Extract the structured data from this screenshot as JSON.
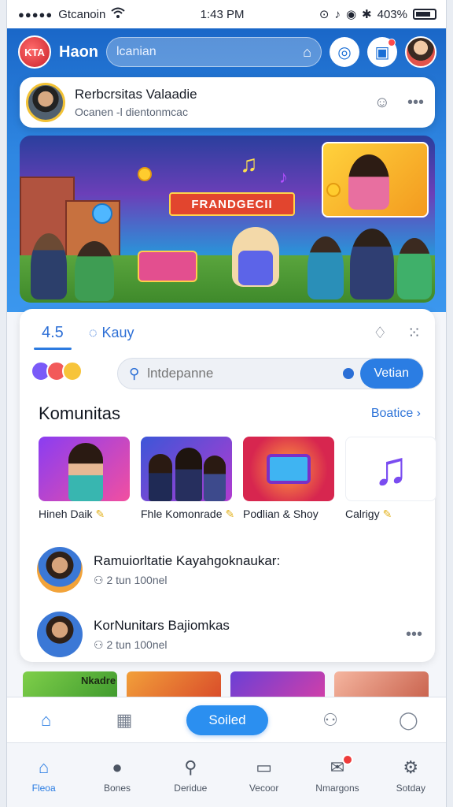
{
  "status_bar": {
    "carrier": "Gtcanoin",
    "time": "1:43 PM",
    "battery": "403%"
  },
  "header": {
    "logo_text": "KTA",
    "brand": "Haon",
    "search_placeholder": "lcanian"
  },
  "profile": {
    "name": "Rerbcrsitas Valaadie",
    "subtitle": "Ocanen -l dientonmcac"
  },
  "hero": {
    "ribbon": "FRANDGECII"
  },
  "tabs": {
    "count": "4.5",
    "second_label": "Kauy"
  },
  "search": {
    "placeholder": "lntdepanne",
    "button": "Vetian"
  },
  "community": {
    "title": "Komunitas",
    "link": "Boatice",
    "tiles": [
      {
        "label": "Hineh Daik"
      },
      {
        "label": "Fhle Komonrade"
      },
      {
        "label": "Podlian & Shoy"
      },
      {
        "label": "Calrigy"
      }
    ]
  },
  "list": [
    {
      "title": "Ramuiorltatie Kayahgoknaukar:",
      "meta": "2 tun 100nel"
    },
    {
      "title": "KorNunitars Bajiomkas",
      "meta": "2 tun 100nel"
    }
  ],
  "strip": {
    "first_label": "Nkadre"
  },
  "actionbar": {
    "primary": "Soiled"
  },
  "nav": [
    {
      "label": "Fleoa"
    },
    {
      "label": "Bones"
    },
    {
      "label": "Deridue"
    },
    {
      "label": "Vecoor"
    },
    {
      "label": "Nmargons"
    },
    {
      "label": "Sotday"
    }
  ],
  "colors": {
    "primary": "#2b7de3",
    "header_gradient_top": "#1a67c8",
    "badge": "#ee3b3b"
  }
}
